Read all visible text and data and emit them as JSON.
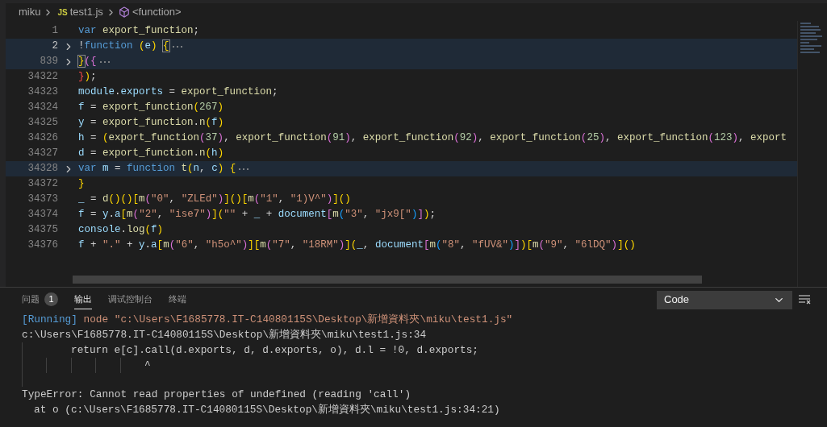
{
  "breadcrumb": {
    "folder": "miku",
    "file_icon_label": "JS",
    "file": "test1.js",
    "symbol": "<function>"
  },
  "code_lines": [
    {
      "number": "1",
      "current": false,
      "folded": false,
      "tokens": [
        {
          "kind": "kw",
          "text": "var "
        },
        {
          "kind": "fn",
          "text": "export_function"
        },
        {
          "kind": "p",
          "text": ";"
        }
      ]
    },
    {
      "number": "2",
      "current": true,
      "folded": true,
      "tokens": [
        {
          "kind": "p",
          "text": "!"
        },
        {
          "kind": "kw",
          "text": "function "
        },
        {
          "kind": "b1",
          "text": "("
        },
        {
          "kind": "var",
          "text": "e"
        },
        {
          "kind": "b1",
          "text": ") "
        },
        {
          "kind": "match",
          "text": "{"
        }
      ]
    },
    {
      "number": "839",
      "current": false,
      "folded": true,
      "tokens": [
        {
          "kind": "match",
          "text": "}"
        },
        {
          "kind": "b2",
          "text": "({"
        }
      ]
    },
    {
      "number": "34322",
      "current": false,
      "folded": false,
      "tokens": [
        {
          "kind": "err",
          "text": "}"
        },
        {
          "kind": "b1",
          "text": ")"
        },
        {
          "kind": "p",
          "text": ";"
        }
      ]
    },
    {
      "number": "34323",
      "current": false,
      "folded": false,
      "tokens": [
        {
          "kind": "var",
          "text": "module"
        },
        {
          "kind": "p",
          "text": "."
        },
        {
          "kind": "var",
          "text": "exports"
        },
        {
          "kind": "p",
          "text": " = "
        },
        {
          "kind": "fn",
          "text": "export_function"
        },
        {
          "kind": "p",
          "text": ";"
        }
      ]
    },
    {
      "number": "34324",
      "current": false,
      "folded": false,
      "tokens": [
        {
          "kind": "var",
          "text": "f"
        },
        {
          "kind": "p",
          "text": " = "
        },
        {
          "kind": "fn",
          "text": "export_function"
        },
        {
          "kind": "b1",
          "text": "("
        },
        {
          "kind": "num",
          "text": "267"
        },
        {
          "kind": "b1",
          "text": ")"
        }
      ]
    },
    {
      "number": "34325",
      "current": false,
      "folded": false,
      "tokens": [
        {
          "kind": "var",
          "text": "y"
        },
        {
          "kind": "p",
          "text": " = "
        },
        {
          "kind": "fn",
          "text": "export_function"
        },
        {
          "kind": "p",
          "text": "."
        },
        {
          "kind": "fn",
          "text": "n"
        },
        {
          "kind": "b1",
          "text": "("
        },
        {
          "kind": "var",
          "text": "f"
        },
        {
          "kind": "b1",
          "text": ")"
        }
      ]
    },
    {
      "number": "34326",
      "current": false,
      "folded": false,
      "tokens": [
        {
          "kind": "var",
          "text": "h"
        },
        {
          "kind": "p",
          "text": " = "
        },
        {
          "kind": "b1",
          "text": "("
        },
        {
          "kind": "fn",
          "text": "export_function"
        },
        {
          "kind": "b2",
          "text": "("
        },
        {
          "kind": "num",
          "text": "37"
        },
        {
          "kind": "b2",
          "text": ")"
        },
        {
          "kind": "p",
          "text": ", "
        },
        {
          "kind": "fn",
          "text": "export_function"
        },
        {
          "kind": "b2",
          "text": "("
        },
        {
          "kind": "num",
          "text": "91"
        },
        {
          "kind": "b2",
          "text": ")"
        },
        {
          "kind": "p",
          "text": ", "
        },
        {
          "kind": "fn",
          "text": "export_function"
        },
        {
          "kind": "b2",
          "text": "("
        },
        {
          "kind": "num",
          "text": "92"
        },
        {
          "kind": "b2",
          "text": ")"
        },
        {
          "kind": "p",
          "text": ", "
        },
        {
          "kind": "fn",
          "text": "export_function"
        },
        {
          "kind": "b2",
          "text": "("
        },
        {
          "kind": "num",
          "text": "25"
        },
        {
          "kind": "b2",
          "text": ")"
        },
        {
          "kind": "p",
          "text": ", "
        },
        {
          "kind": "fn",
          "text": "export_function"
        },
        {
          "kind": "b2",
          "text": "("
        },
        {
          "kind": "num",
          "text": "123"
        },
        {
          "kind": "b2",
          "text": ")"
        },
        {
          "kind": "p",
          "text": ", "
        },
        {
          "kind": "fn",
          "text": "export"
        }
      ]
    },
    {
      "number": "34327",
      "current": false,
      "folded": false,
      "tokens": [
        {
          "kind": "var",
          "text": "d"
        },
        {
          "kind": "p",
          "text": " = "
        },
        {
          "kind": "fn",
          "text": "export_function"
        },
        {
          "kind": "p",
          "text": "."
        },
        {
          "kind": "fn",
          "text": "n"
        },
        {
          "kind": "b1",
          "text": "("
        },
        {
          "kind": "var",
          "text": "h"
        },
        {
          "kind": "b1",
          "text": ")"
        }
      ]
    },
    {
      "number": "34328",
      "current": false,
      "folded": true,
      "tokens": [
        {
          "kind": "kw",
          "text": "var "
        },
        {
          "kind": "var",
          "text": "m"
        },
        {
          "kind": "p",
          "text": " = "
        },
        {
          "kind": "kw",
          "text": "function "
        },
        {
          "kind": "fn",
          "text": "t"
        },
        {
          "kind": "b1",
          "text": "("
        },
        {
          "kind": "var",
          "text": "n"
        },
        {
          "kind": "p",
          "text": ", "
        },
        {
          "kind": "var",
          "text": "c"
        },
        {
          "kind": "b1",
          "text": ") {"
        }
      ]
    },
    {
      "number": "34372",
      "current": false,
      "folded": false,
      "tokens": [
        {
          "kind": "b1",
          "text": "}"
        }
      ]
    },
    {
      "number": "34373",
      "current": false,
      "folded": false,
      "tokens": [
        {
          "kind": "var",
          "text": "_"
        },
        {
          "kind": "p",
          "text": " = "
        },
        {
          "kind": "fn",
          "text": "d"
        },
        {
          "kind": "b1",
          "text": "()()["
        },
        {
          "kind": "fn",
          "text": "m"
        },
        {
          "kind": "b2",
          "text": "("
        },
        {
          "kind": "str",
          "text": "\"0\""
        },
        {
          "kind": "p",
          "text": ", "
        },
        {
          "kind": "str",
          "text": "\"ZLEd\""
        },
        {
          "kind": "b2",
          "text": ")"
        },
        {
          "kind": "b1",
          "text": "]()["
        },
        {
          "kind": "fn",
          "text": "m"
        },
        {
          "kind": "b2",
          "text": "("
        },
        {
          "kind": "str",
          "text": "\"1\""
        },
        {
          "kind": "p",
          "text": ", "
        },
        {
          "kind": "str",
          "text": "\"1)V^\""
        },
        {
          "kind": "b2",
          "text": ")"
        },
        {
          "kind": "b1",
          "text": "]()"
        }
      ]
    },
    {
      "number": "34374",
      "current": false,
      "folded": false,
      "tokens": [
        {
          "kind": "var",
          "text": "f"
        },
        {
          "kind": "p",
          "text": " = "
        },
        {
          "kind": "var",
          "text": "y"
        },
        {
          "kind": "p",
          "text": "."
        },
        {
          "kind": "var",
          "text": "a"
        },
        {
          "kind": "b1",
          "text": "["
        },
        {
          "kind": "fn",
          "text": "m"
        },
        {
          "kind": "b2",
          "text": "("
        },
        {
          "kind": "str",
          "text": "\"2\""
        },
        {
          "kind": "p",
          "text": ", "
        },
        {
          "kind": "str",
          "text": "\"ise7\""
        },
        {
          "kind": "b2",
          "text": ")"
        },
        {
          "kind": "b1",
          "text": "]("
        },
        {
          "kind": "str",
          "text": "\"\""
        },
        {
          "kind": "p",
          "text": " + "
        },
        {
          "kind": "var",
          "text": "_"
        },
        {
          "kind": "p",
          "text": " + "
        },
        {
          "kind": "var",
          "text": "document"
        },
        {
          "kind": "b2",
          "text": "["
        },
        {
          "kind": "fn",
          "text": "m"
        },
        {
          "kind": "b3",
          "text": "("
        },
        {
          "kind": "str",
          "text": "\"3\""
        },
        {
          "kind": "p",
          "text": ", "
        },
        {
          "kind": "str",
          "text": "\"jx9[\""
        },
        {
          "kind": "b3",
          "text": ")"
        },
        {
          "kind": "b2",
          "text": "]"
        },
        {
          "kind": "b1",
          "text": ")"
        },
        {
          "kind": "p",
          "text": ";"
        }
      ]
    },
    {
      "number": "34375",
      "current": false,
      "folded": false,
      "tokens": [
        {
          "kind": "var",
          "text": "console"
        },
        {
          "kind": "p",
          "text": "."
        },
        {
          "kind": "fn",
          "text": "log"
        },
        {
          "kind": "b1",
          "text": "("
        },
        {
          "kind": "var",
          "text": "f"
        },
        {
          "kind": "b1",
          "text": ")"
        }
      ]
    },
    {
      "number": "34376",
      "current": false,
      "folded": false,
      "tokens": [
        {
          "kind": "var",
          "text": "f"
        },
        {
          "kind": "p",
          "text": " + "
        },
        {
          "kind": "str",
          "text": "\".\""
        },
        {
          "kind": "p",
          "text": " + "
        },
        {
          "kind": "var",
          "text": "y"
        },
        {
          "kind": "p",
          "text": "."
        },
        {
          "kind": "var",
          "text": "a"
        },
        {
          "kind": "b1",
          "text": "["
        },
        {
          "kind": "fn",
          "text": "m"
        },
        {
          "kind": "b2",
          "text": "("
        },
        {
          "kind": "str",
          "text": "\"6\""
        },
        {
          "kind": "p",
          "text": ", "
        },
        {
          "kind": "str",
          "text": "\"h5o^\""
        },
        {
          "kind": "b2",
          "text": ")"
        },
        {
          "kind": "b1",
          "text": "]["
        },
        {
          "kind": "fn",
          "text": "m"
        },
        {
          "kind": "b2",
          "text": "("
        },
        {
          "kind": "str",
          "text": "\"7\""
        },
        {
          "kind": "p",
          "text": ", "
        },
        {
          "kind": "str",
          "text": "\"18RM\""
        },
        {
          "kind": "b2",
          "text": ")"
        },
        {
          "kind": "b1",
          "text": "]("
        },
        {
          "kind": "var",
          "text": "_"
        },
        {
          "kind": "p",
          "text": ", "
        },
        {
          "kind": "var",
          "text": "document"
        },
        {
          "kind": "b2",
          "text": "["
        },
        {
          "kind": "fn",
          "text": "m"
        },
        {
          "kind": "b3",
          "text": "("
        },
        {
          "kind": "str",
          "text": "\"8\""
        },
        {
          "kind": "p",
          "text": ", "
        },
        {
          "kind": "str",
          "text": "\"fUV&\""
        },
        {
          "kind": "b3",
          "text": ")"
        },
        {
          "kind": "b2",
          "text": "]"
        },
        {
          "kind": "b1",
          "text": ")["
        },
        {
          "kind": "fn",
          "text": "m"
        },
        {
          "kind": "b2",
          "text": "("
        },
        {
          "kind": "str",
          "text": "\"9\""
        },
        {
          "kind": "p",
          "text": ", "
        },
        {
          "kind": "str",
          "text": "\"6lDQ\""
        },
        {
          "kind": "b2",
          "text": ")"
        },
        {
          "kind": "b1",
          "text": "]()"
        }
      ]
    }
  ],
  "panel": {
    "tabs": [
      {
        "label": "问题",
        "badge": "1",
        "selected": false
      },
      {
        "label": "输出",
        "selected": true
      },
      {
        "label": "调试控制台",
        "selected": false
      },
      {
        "label": "终端",
        "selected": false
      }
    ],
    "channel_select": {
      "value": "Code"
    },
    "output_lines": [
      {
        "kind": "running",
        "tag": "[Running]",
        "text": "node \"c:\\Users\\F1685778.IT-C14080115S\\Desktop\\新增資料夾\\miku\\test1.js\""
      },
      {
        "kind": "plain",
        "text": "c:\\Users\\F1685778.IT-C14080115S\\Desktop\\新增資料夾\\miku\\test1.js:34"
      },
      {
        "kind": "source",
        "text": "return e[c].call(d.exports, d, d.exports, o), d.l = !0, d.exports;"
      },
      {
        "kind": "pointer",
        "text": "^"
      },
      {
        "kind": "error",
        "text": "TypeError: Cannot read properties of undefined (reading 'call')"
      },
      {
        "kind": "stack",
        "text": "at o (c:\\Users\\F1685778.IT-C14080115S\\Desktop\\新增資料夾\\miku\\test1.js:34:21)"
      }
    ]
  }
}
